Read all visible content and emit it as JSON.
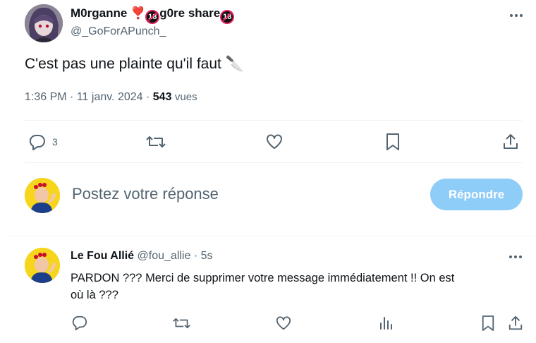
{
  "tweet": {
    "display_name": "M0rganne",
    "heart_emoji": "❣️",
    "name_mid": "g0re share",
    "badge_text": "18",
    "handle": "@_GoForAPunch_",
    "text": "C'est pas une plainte qu'il faut 🔪",
    "time": "1:36 PM",
    "date": "11 janv. 2024",
    "views_count": "543",
    "views_label": "vues",
    "reply_count": "3",
    "more_icon": "more-dots-icon"
  },
  "composer": {
    "placeholder": "Postez votre réponse",
    "button_label": "Répondre",
    "button_color": "#8ecdf8"
  },
  "reply": {
    "display_name": "Le Fou Allié",
    "handle": "@fou_allie",
    "time": "5s",
    "text_line1": "PARDON ??? Merci de supprimer votre message immédiatement !! On est",
    "text_line2": "où là ???"
  },
  "colors": {
    "text": "#0f1419",
    "muted": "#536471",
    "accent": "#1d9bf0",
    "divider": "#eff3f4"
  }
}
